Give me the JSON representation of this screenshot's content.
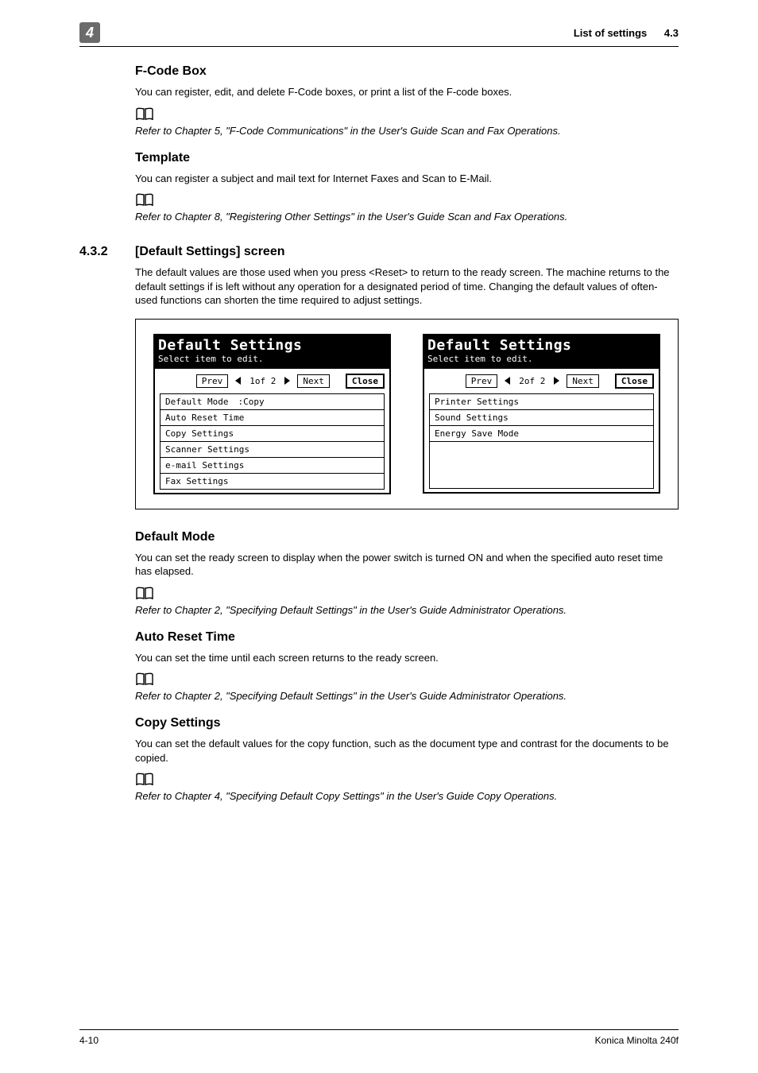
{
  "header": {
    "chapter_badge": "4",
    "running_head": "List of settings",
    "running_secnum": "4.3"
  },
  "s_fcode": {
    "title": "F-Code Box",
    "body": "You can register, edit, and delete F-Code boxes, or print a list of the F-code boxes.",
    "ref": "Refer to Chapter 5, \"F-Code Communications\" in the User's Guide Scan and Fax Operations."
  },
  "s_template": {
    "title": "Template",
    "body": "You can register a subject and mail text for Internet Faxes and Scan to E-Mail.",
    "ref": "Refer to Chapter 8, \"Registering Other Settings\" in the User's Guide Scan and Fax Operations."
  },
  "sec": {
    "num": "4.3.2",
    "title": "[Default Settings] screen",
    "body": "The default values are those used when you press <Reset> to return to the ready screen. The machine returns to the default settings if is left without any operation for a designated period of time. Changing the default values of often-used functions can shorten the time required to adjust settings."
  },
  "fig": {
    "lcd_title": "Default Settings",
    "lcd_sub": "Select item to edit.",
    "btn_prev": "Prev",
    "btn_next": "Next",
    "btn_close": "Close",
    "page1_ind": "1of  2",
    "page2_ind": "2of  2",
    "page1_items": [
      {
        "label": "Default Mode",
        "value": ":Copy"
      },
      {
        "label": "Auto Reset Time"
      },
      {
        "label": "Copy Settings"
      },
      {
        "label": "Scanner Settings"
      },
      {
        "label": "e-mail Settings"
      },
      {
        "label": "Fax Settings"
      }
    ],
    "page2_items": [
      {
        "label": "Printer Settings"
      },
      {
        "label": "Sound Settings"
      },
      {
        "label": "Energy Save Mode"
      }
    ]
  },
  "s_defmode": {
    "title": "Default Mode",
    "body": "You can set the ready screen to display when the power switch is turned ON and when the specified auto reset time has elapsed.",
    "ref": "Refer to Chapter 2, \"Specifying Default Settings\" in the User's Guide Administrator Operations."
  },
  "s_autoreset": {
    "title": "Auto Reset Time",
    "body": "You can set the time until each screen returns to the ready screen.",
    "ref": "Refer to Chapter 2, \"Specifying Default Settings\" in the User's Guide Administrator Operations."
  },
  "s_copy": {
    "title": "Copy Settings",
    "body": "You can set the default values for the copy function, such as the document type and contrast for the documents to be copied.",
    "ref": "Refer to Chapter 4, \"Specifying Default Copy Settings\" in the User's Guide Copy Operations."
  },
  "footer": {
    "page": "4-10",
    "product": "Konica Minolta 240f"
  }
}
